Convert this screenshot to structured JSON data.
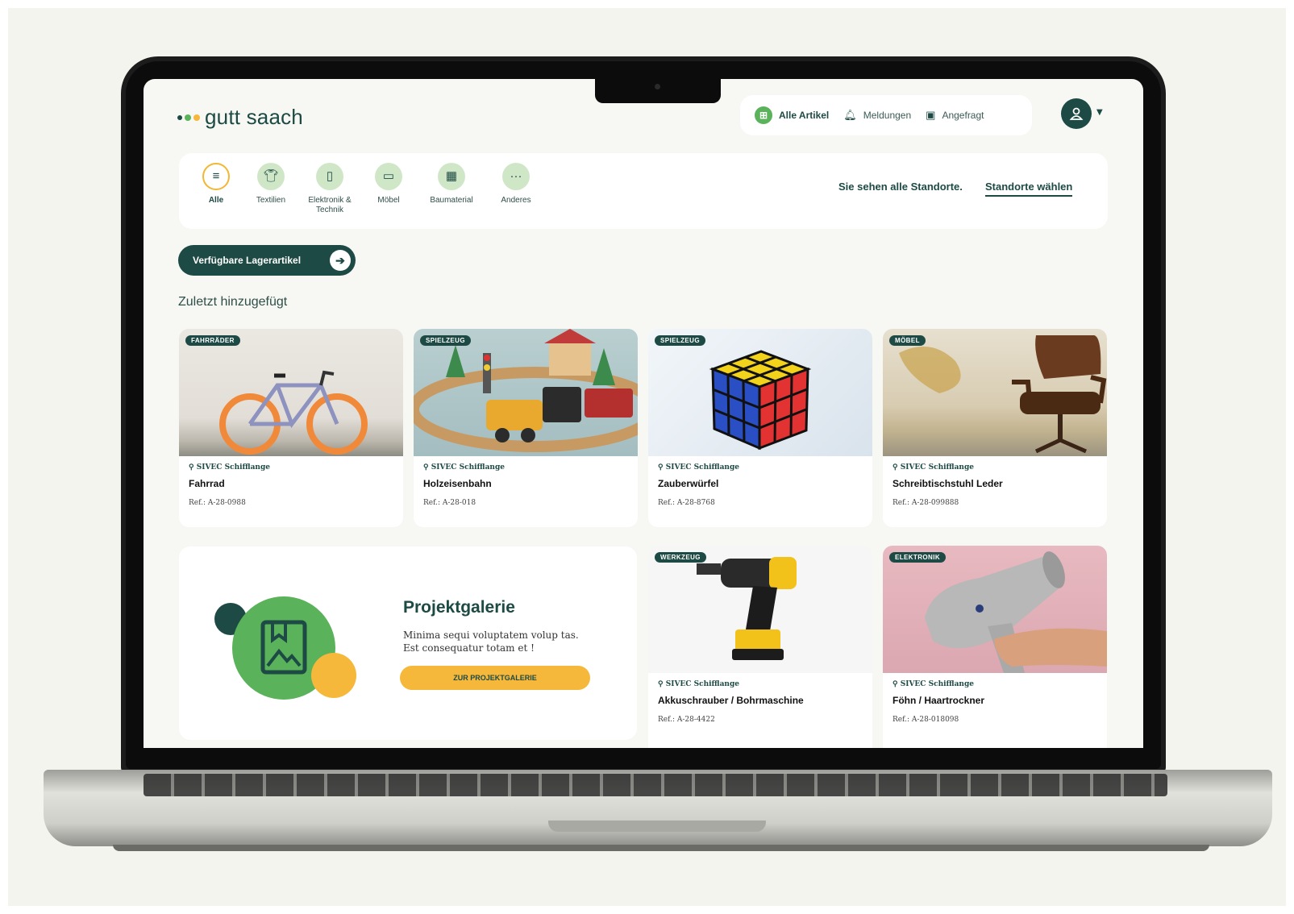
{
  "brand": {
    "name": "gutt saach",
    "dot_colors": [
      "#1d4a44",
      "#5ab25a",
      "#f6b83b"
    ]
  },
  "topnav": {
    "items": [
      {
        "label": "Alle Artikel",
        "icon": "grid-icon",
        "active": true
      },
      {
        "label": "Meldungen",
        "icon": "bell-icon",
        "active": false
      },
      {
        "label": "Angefragt",
        "icon": "inbox-icon",
        "active": false
      }
    ],
    "avatar_icon": "user-icon"
  },
  "categories": [
    {
      "label": "Alle",
      "icon": "list-icon",
      "active": true
    },
    {
      "label": "Textilien",
      "icon": "shirt-icon",
      "active": false
    },
    {
      "label": "Elektronik & Technik",
      "icon": "phone-icon",
      "active": false
    },
    {
      "label": "Möbel",
      "icon": "sofa-icon",
      "active": false
    },
    {
      "label": "Baumaterial",
      "icon": "brick-icon",
      "active": false
    },
    {
      "label": "Anderes",
      "icon": "more-icon",
      "active": false
    }
  ],
  "location": {
    "note": "Sie sehen alle Standorte.",
    "link": "Standorte wählen"
  },
  "stock_button": {
    "label": "Verfügbare Lagerartikel"
  },
  "section": {
    "title": "Zuletzt hinzugefügt"
  },
  "items": [
    {
      "tag": "FAHRRÄDER",
      "location": "SIVEC Schifflange",
      "title": "Fahrrad",
      "ref": "Ref.: A-28-0988"
    },
    {
      "tag": "SPIELZEUG",
      "location": "SIVEC Schifflange",
      "title": "Holzeisenbahn",
      "ref": "Ref.: A-28-018"
    },
    {
      "tag": "SPIELZEUG",
      "location": "SIVEC Schifflange",
      "title": "Zauberwürfel",
      "ref": "Ref.: A-28-8768"
    },
    {
      "tag": "MÖBEL",
      "location": "SIVEC Schifflange",
      "title": "Schreibtischstuhl Leder",
      "ref": "Ref.: A-28-099888"
    },
    {
      "tag": "WERKZEUG",
      "location": "SIVEC Schifflange",
      "title": "Akkuschrauber / Bohrmaschine",
      "ref": "Ref.: A-28-4422"
    },
    {
      "tag": "ELEKTRONIK",
      "location": "SIVEC Schifflange",
      "title": "Föhn / Haartrockner",
      "ref": "Ref.: A-28-018098"
    }
  ],
  "promo": {
    "title": "Projektgalerie",
    "text": "Minima sequi voluptatem volup tas. Est consequatur totam et !",
    "button": "ZUR PROJEKTGALERIE"
  },
  "colors": {
    "primary": "#1d4a44",
    "green": "#5ab25a",
    "yellow": "#f6b83b",
    "mint": "#cfe7c6"
  }
}
